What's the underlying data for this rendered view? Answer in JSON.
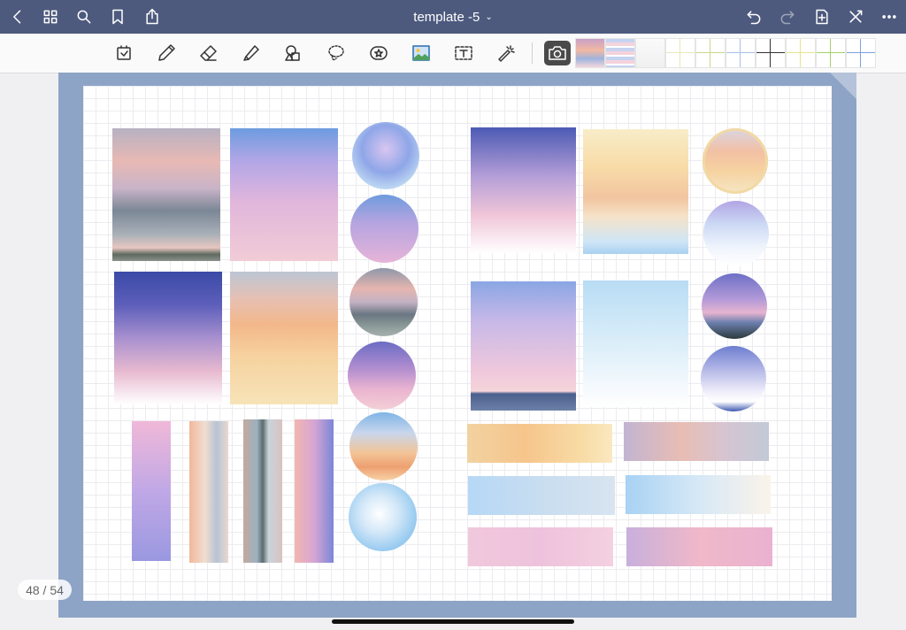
{
  "topbar": {
    "title": "template -5",
    "title_chevron": "⌄",
    "left_icons": [
      "back-icon",
      "grid-icon",
      "search-icon",
      "bookmark-icon",
      "share-icon"
    ],
    "right_icons": [
      "undo-icon",
      "redo-icon",
      "add-page-icon",
      "close-icon",
      "more-icon"
    ]
  },
  "toolbar": {
    "tools": [
      "sticker-icon",
      "pen-icon",
      "eraser-icon",
      "highlighter-icon",
      "shapes-icon",
      "lasso-icon",
      "elements-icon",
      "image-icon",
      "text-icon",
      "laser-pointer-icon",
      "camera-icon"
    ],
    "active_tool": "camera-icon"
  },
  "document": {
    "page_indicator": "48 / 54",
    "frame_color": "#8ea4c6"
  }
}
